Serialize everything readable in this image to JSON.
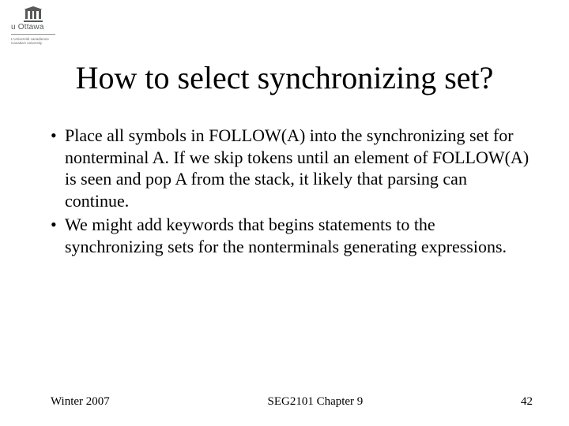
{
  "logo": {
    "name": "u Ottawa",
    "subline1": "L'Université canadienne",
    "subline2": "Canada's university"
  },
  "title": "How to select synchronizing set?",
  "bullets": [
    "Place all symbols in FOLLOW(A) into the synchronizing set for nonterminal A. If we skip tokens until an element of FOLLOW(A) is seen and pop A from the stack, it likely that parsing can continue.",
    "We might add keywords that begins statements to the synchronizing sets for the nonterminals generating expressions."
  ],
  "footer": {
    "left": "Winter 2007",
    "center": "SEG2101 Chapter 9",
    "right": "42"
  }
}
